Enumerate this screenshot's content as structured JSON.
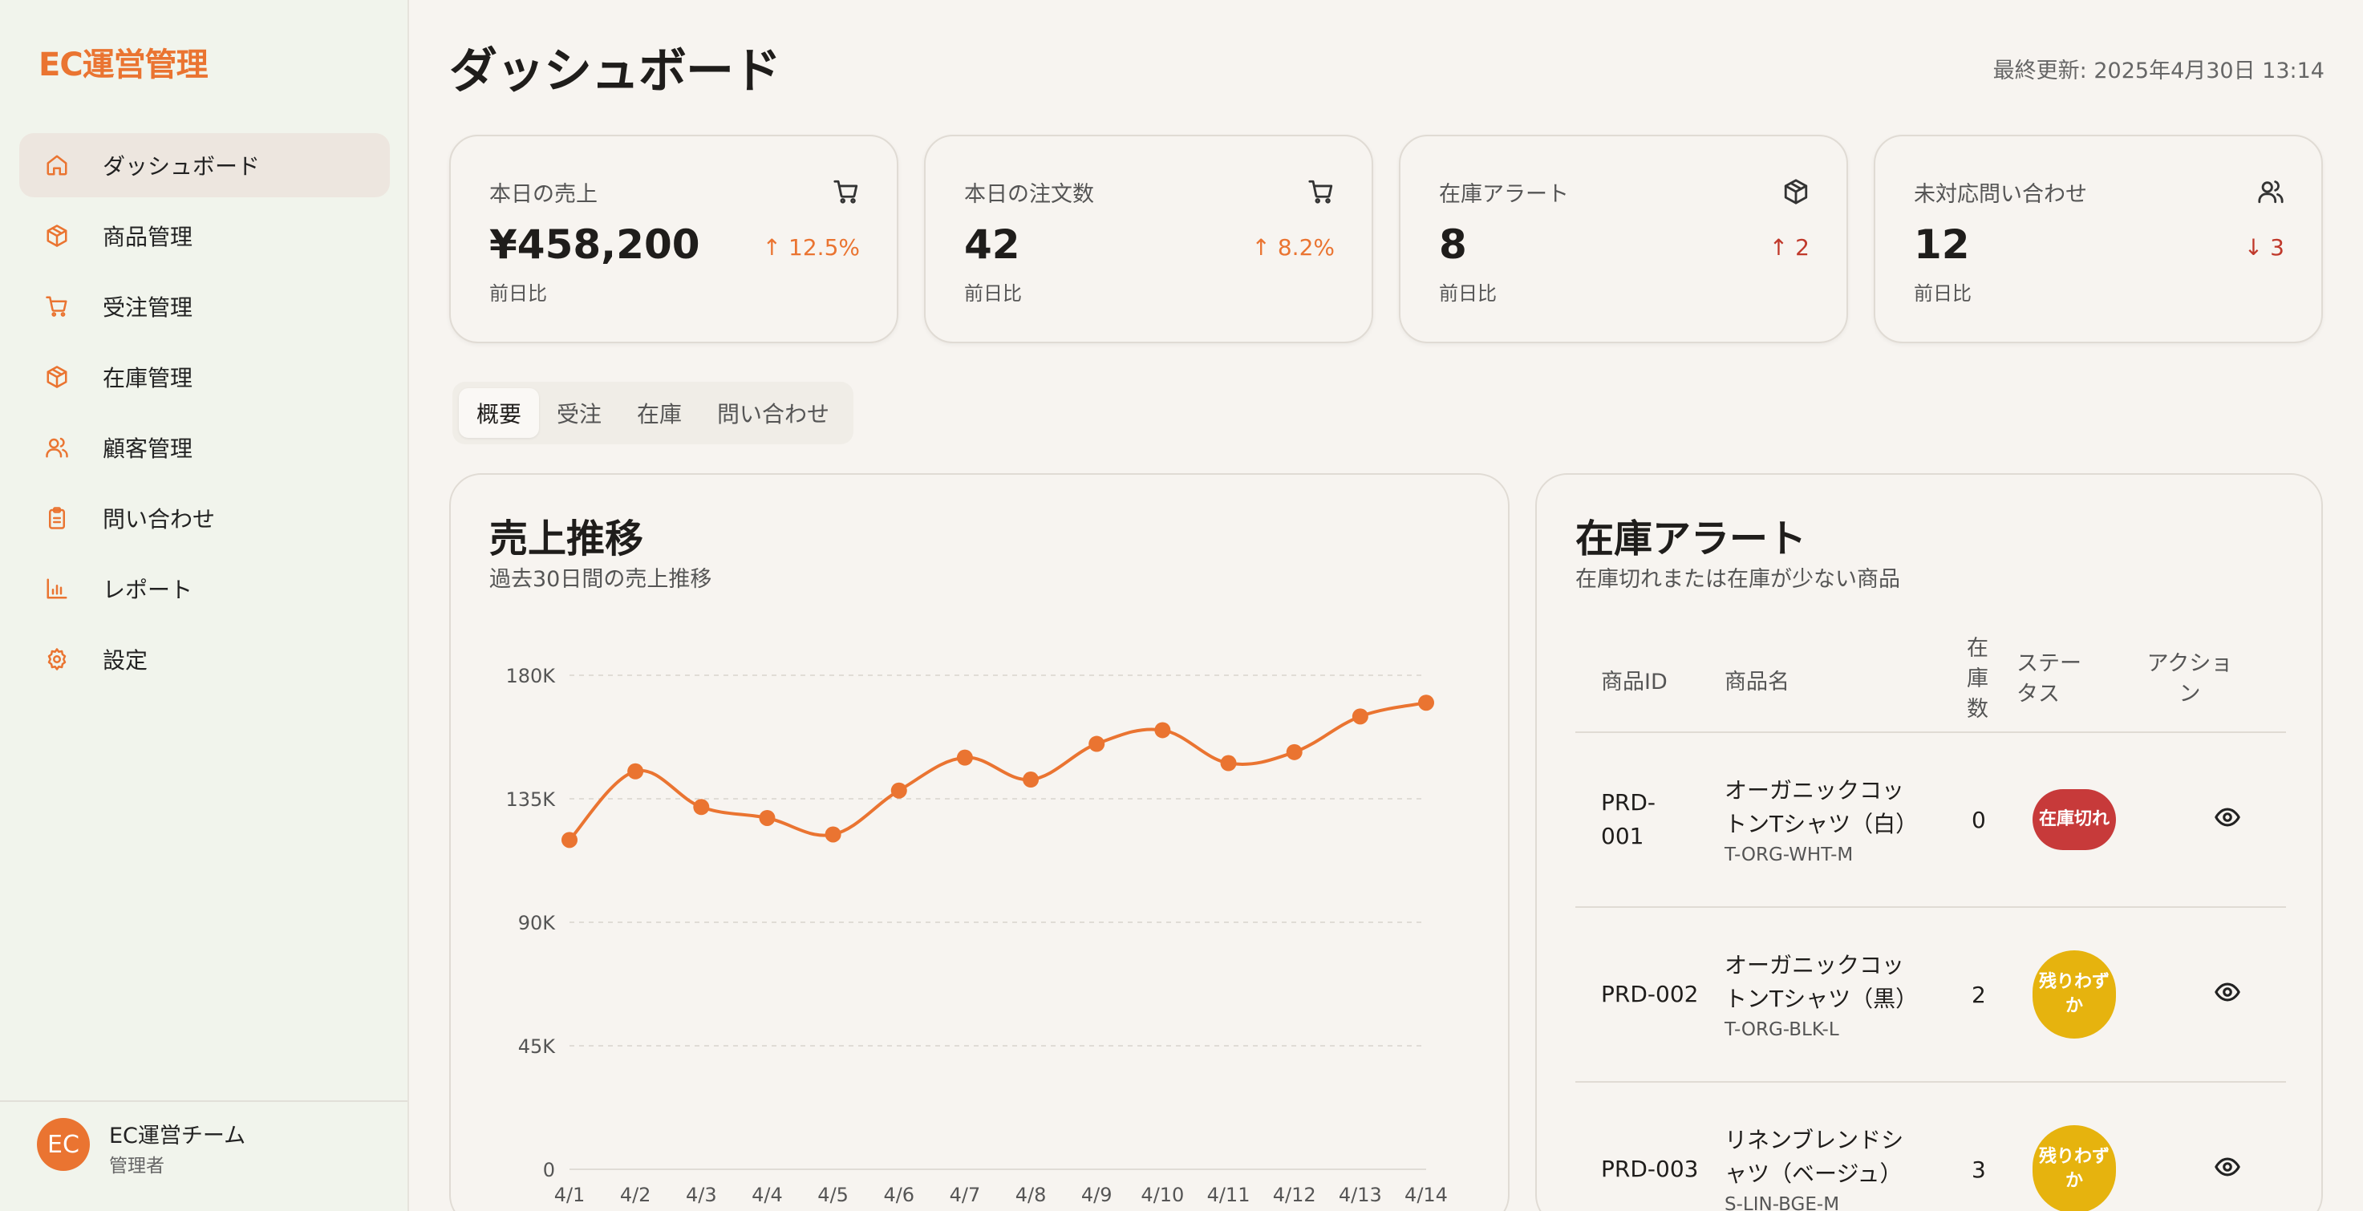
{
  "sidebar": {
    "brand": "EC運営管理",
    "items": [
      {
        "label": "ダッシュボード",
        "icon": "home-icon",
        "active": true
      },
      {
        "label": "商品管理",
        "icon": "box-icon"
      },
      {
        "label": "受注管理",
        "icon": "cart-icon"
      },
      {
        "label": "在庫管理",
        "icon": "box-icon"
      },
      {
        "label": "顧客管理",
        "icon": "users-icon"
      },
      {
        "label": "問い合わせ",
        "icon": "clipboard-icon"
      },
      {
        "label": "レポート",
        "icon": "bar-chart-icon"
      },
      {
        "label": "設定",
        "icon": "gear-icon"
      }
    ],
    "user": {
      "avatar": "EC",
      "name": "EC運営チーム",
      "role": "管理者"
    }
  },
  "header": {
    "title": "ダッシュボード",
    "last_updated": "最終更新: 2025年4月30日 13:14"
  },
  "kpis": [
    {
      "label": "本日の売上",
      "value": "¥458,200",
      "change": "12.5%",
      "direction": "up",
      "sub": "前日比",
      "icon": "cart-icon"
    },
    {
      "label": "本日の注文数",
      "value": "42",
      "change": "8.2%",
      "direction": "up",
      "sub": "前日比",
      "icon": "cart-icon"
    },
    {
      "label": "在庫アラート",
      "value": "8",
      "change": "2",
      "direction": "up",
      "sub": "前日比",
      "icon": "box-icon"
    },
    {
      "label": "未対応問い合わせ",
      "value": "12",
      "change": "3",
      "direction": "down",
      "sub": "前日比",
      "icon": "users-icon"
    }
  ],
  "tabs": [
    "概要",
    "受注",
    "在庫",
    "問い合わせ"
  ],
  "sales_card": {
    "title": "売上推移",
    "subtitle": "過去30日間の売上推移"
  },
  "chart_data": {
    "type": "line",
    "categories": [
      "4/1",
      "4/2",
      "4/3",
      "4/4",
      "4/5",
      "4/6",
      "4/7",
      "4/8",
      "4/9",
      "4/10",
      "4/11",
      "4/12",
      "4/13",
      "4/14"
    ],
    "values": [
      120000,
      145000,
      132000,
      128000,
      122000,
      138000,
      150000,
      142000,
      155000,
      160000,
      148000,
      152000,
      165000,
      170000
    ],
    "yticks": [
      "0",
      "45K",
      "90K",
      "135K",
      "180K"
    ],
    "ylim": [
      0,
      180000
    ],
    "grid": true,
    "color": "#ea7431"
  },
  "stock_card": {
    "title": "在庫アラート",
    "subtitle": "在庫切れまたは在庫が少ない商品",
    "headers": {
      "id": "商品ID",
      "name": "商品名",
      "qty": "在庫数",
      "status": "ステータス",
      "action": "アクション"
    },
    "rows": [
      {
        "id": "PRD-001",
        "name": "オーガニックコットンTシャツ（白）",
        "sku": "T-ORG-WHT-M",
        "qty": "0",
        "status": "在庫切れ",
        "status_type": "out"
      },
      {
        "id": "PRD-002",
        "name": "オーガニックコットンTシャツ（黒）",
        "sku": "T-ORG-BLK-L",
        "qty": "2",
        "status": "残りわずか",
        "status_type": "low"
      },
      {
        "id": "PRD-003",
        "name": "リネンブレンドシャツ（ベージュ）",
        "sku": "S-LIN-BGE-M",
        "qty": "3",
        "status": "残りわずか",
        "status_type": "low"
      }
    ]
  },
  "colors": {
    "accent": "#ea7431",
    "danger": "#c73a3a",
    "warning": "#e6b30e"
  }
}
